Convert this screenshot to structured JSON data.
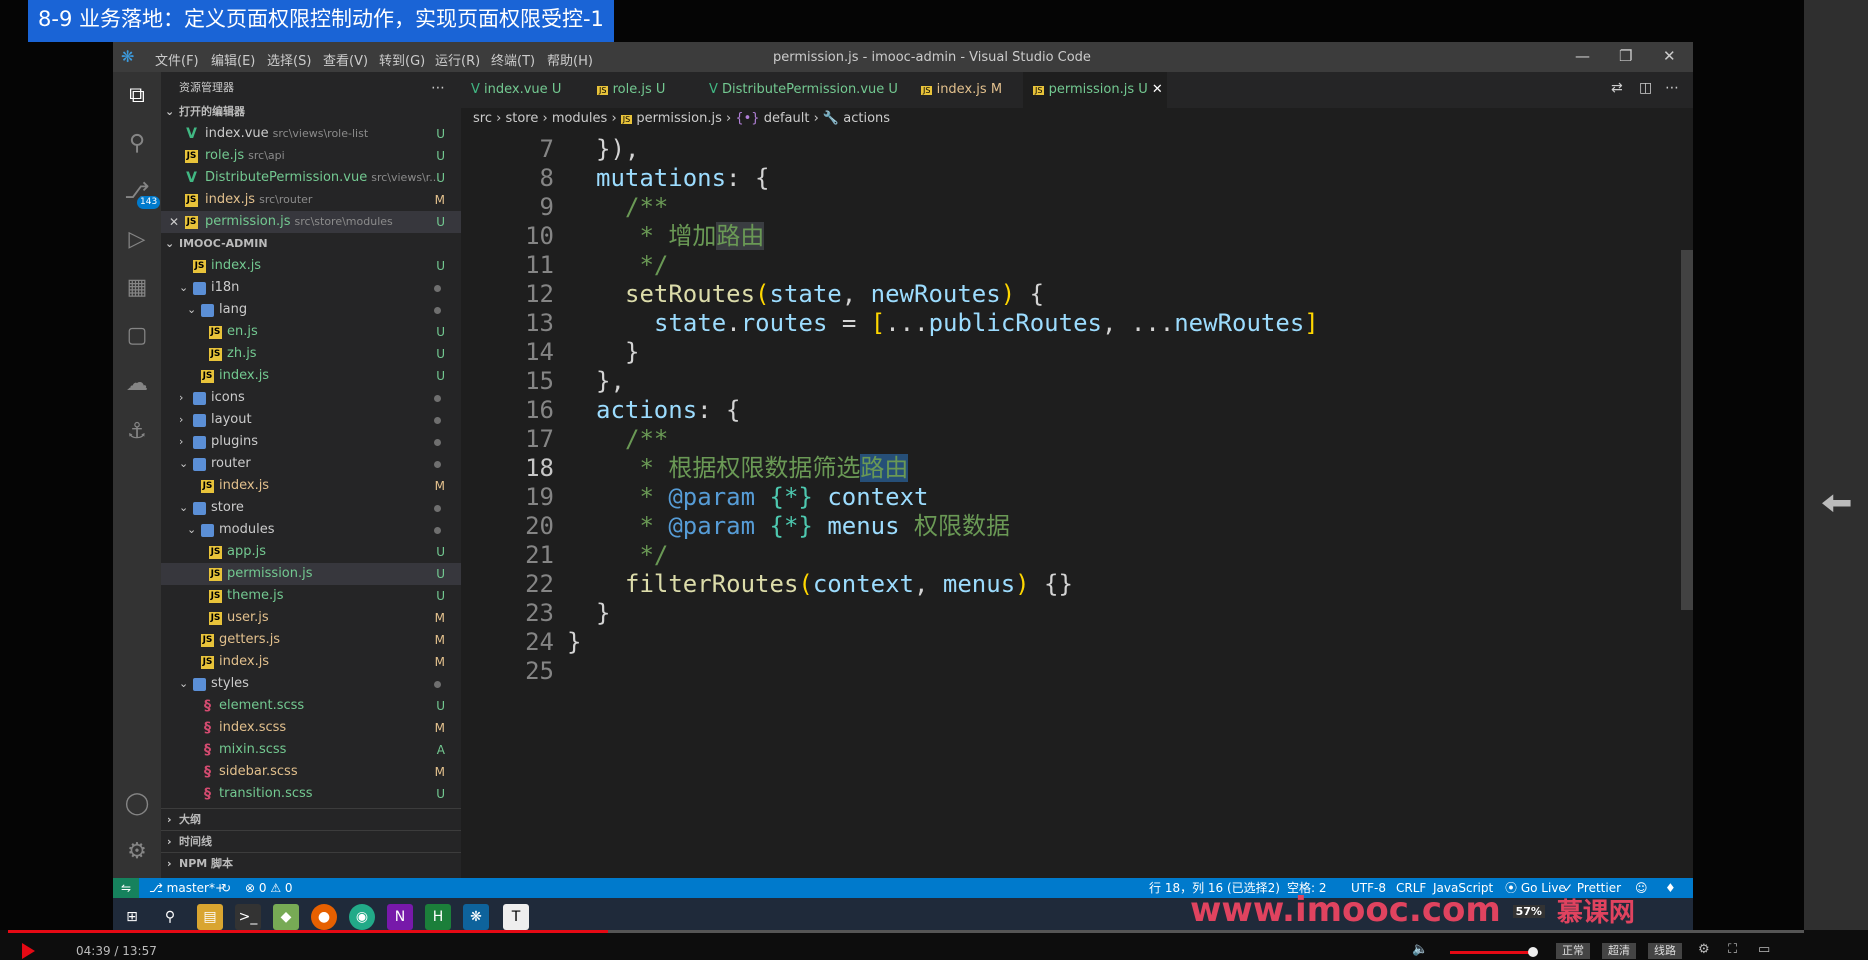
{
  "video_title": "8-9 业务落地：定义页面权限控制动作，实现页面权限受控-1",
  "window": {
    "title": "permission.js - imooc-admin - Visual Studio Code",
    "menu": [
      "文件(F)",
      "编辑(E)",
      "选择(S)",
      "查看(V)",
      "转到(G)",
      "运行(R)",
      "终端(T)",
      "帮助(H)"
    ]
  },
  "activity": {
    "scm_badge": "143"
  },
  "sidebar": {
    "header": "资源管理器",
    "open_editors_label": "打开的编辑器",
    "open_editors": [
      {
        "name": "index.vue",
        "path": "src\\views\\role-list",
        "badge": "U",
        "type": "vue"
      },
      {
        "name": "role.js",
        "path": "src\\api",
        "badge": "U",
        "type": "js"
      },
      {
        "name": "DistributePermission.vue",
        "path": "src\\views\\r...",
        "badge": "U",
        "type": "vue"
      },
      {
        "name": "index.js",
        "path": "src\\router",
        "badge": "M",
        "type": "js"
      },
      {
        "name": "permission.js",
        "path": "src\\store\\modules",
        "badge": "U",
        "type": "js"
      }
    ],
    "project_label": "IMOOC-ADMIN",
    "tree": [
      {
        "name": "index.js",
        "badge": "U",
        "type": "js"
      },
      {
        "name": "i18n",
        "badge": "",
        "type": "folder"
      },
      {
        "name": "lang",
        "badge": "",
        "type": "folder"
      },
      {
        "name": "en.js",
        "badge": "U",
        "type": "js"
      },
      {
        "name": "zh.js",
        "badge": "U",
        "type": "js"
      },
      {
        "name": "index.js",
        "badge": "U",
        "type": "js"
      },
      {
        "name": "icons",
        "badge": "",
        "type": "folder"
      },
      {
        "name": "layout",
        "badge": "",
        "type": "folder"
      },
      {
        "name": "plugins",
        "badge": "",
        "type": "folder"
      },
      {
        "name": "router",
        "badge": "",
        "type": "folder"
      },
      {
        "name": "index.js",
        "badge": "M",
        "type": "js"
      },
      {
        "name": "store",
        "badge": "",
        "type": "folder"
      },
      {
        "name": "modules",
        "badge": "",
        "type": "folder"
      },
      {
        "name": "app.js",
        "badge": "U",
        "type": "js"
      },
      {
        "name": "permission.js",
        "badge": "U",
        "type": "js"
      },
      {
        "name": "theme.js",
        "badge": "U",
        "type": "js"
      },
      {
        "name": "user.js",
        "badge": "M",
        "type": "js"
      },
      {
        "name": "getters.js",
        "badge": "M",
        "type": "js"
      },
      {
        "name": "index.js",
        "badge": "M",
        "type": "js"
      },
      {
        "name": "styles",
        "badge": "",
        "type": "folder"
      },
      {
        "name": "element.scss",
        "badge": "U",
        "type": "scss"
      },
      {
        "name": "index.scss",
        "badge": "M",
        "type": "scss"
      },
      {
        "name": "mixin.scss",
        "badge": "A",
        "type": "scss"
      },
      {
        "name": "sidebar.scss",
        "badge": "M",
        "type": "scss"
      },
      {
        "name": "transition.scss",
        "badge": "U",
        "type": "scss"
      }
    ],
    "outline_label": "大纲",
    "timeline_label": "时间线",
    "npm_label": "NPM 脚本"
  },
  "tabs": [
    {
      "name": "index.vue",
      "badge": "U",
      "type": "vue"
    },
    {
      "name": "role.js",
      "badge": "U",
      "type": "js"
    },
    {
      "name": "DistributePermission.vue",
      "badge": "U",
      "type": "vue"
    },
    {
      "name": "index.js",
      "badge": "M",
      "type": "js"
    },
    {
      "name": "permission.js",
      "badge": "U",
      "type": "js"
    }
  ],
  "breadcrumb": [
    "src",
    "store",
    "modules",
    "permission.js",
    "default",
    "actions"
  ],
  "code": {
    "line_numbers": [
      "7",
      "8",
      "9",
      "10",
      "11",
      "12",
      "13",
      "14",
      "15",
      "16",
      "17",
      "18",
      "19",
      "20",
      "21",
      "22",
      "23",
      "24",
      "25"
    ],
    "l7": "}),",
    "l8a": "mutations",
    "l8b": ": {",
    "l9": "/**",
    "l10a": " * 增加",
    "l10b": "路由",
    "l11": " */",
    "l12a": "setRoutes",
    "l12b": "state",
    "l12c": "newRoutes",
    "l13a": "state",
    "l13b": "routes",
    "l13c": "publicRoutes",
    "l13d": "newRoutes",
    "l14": "}",
    "l15": "},",
    "l16a": "actions",
    "l16b": ": {",
    "l17": "/**",
    "l18a": " * 根据权限数据筛选",
    "l18b": "路由",
    "l19a": "@param",
    "l19b": "{*}",
    "l19c": "context",
    "l20a": "@param",
    "l20b": "{*}",
    "l20c": "menus",
    "l20d": "权限数据",
    "l21": " */",
    "l22a": "filterRoutes",
    "l22b": "context",
    "l22c": "menus",
    "l23": "}",
    "l24": "}"
  },
  "status": {
    "branch": "master*+",
    "problems": "⊗ 0 ⚠ 0",
    "position": "行 18，列 16 (已选择2)",
    "indent": "空格: 2",
    "encoding": "UTF-8",
    "eol": "CRLF",
    "language": "JavaScript",
    "golive": "Go Live",
    "prettier": "✓ Prettier"
  },
  "watermark": "www.imooc.com",
  "battery": "57%",
  "brand": "慕课网",
  "player": {
    "time": "04:39 / 13:57",
    "progress": 0.334,
    "quality_buttons": [
      "正常",
      "超清",
      "线路"
    ]
  }
}
